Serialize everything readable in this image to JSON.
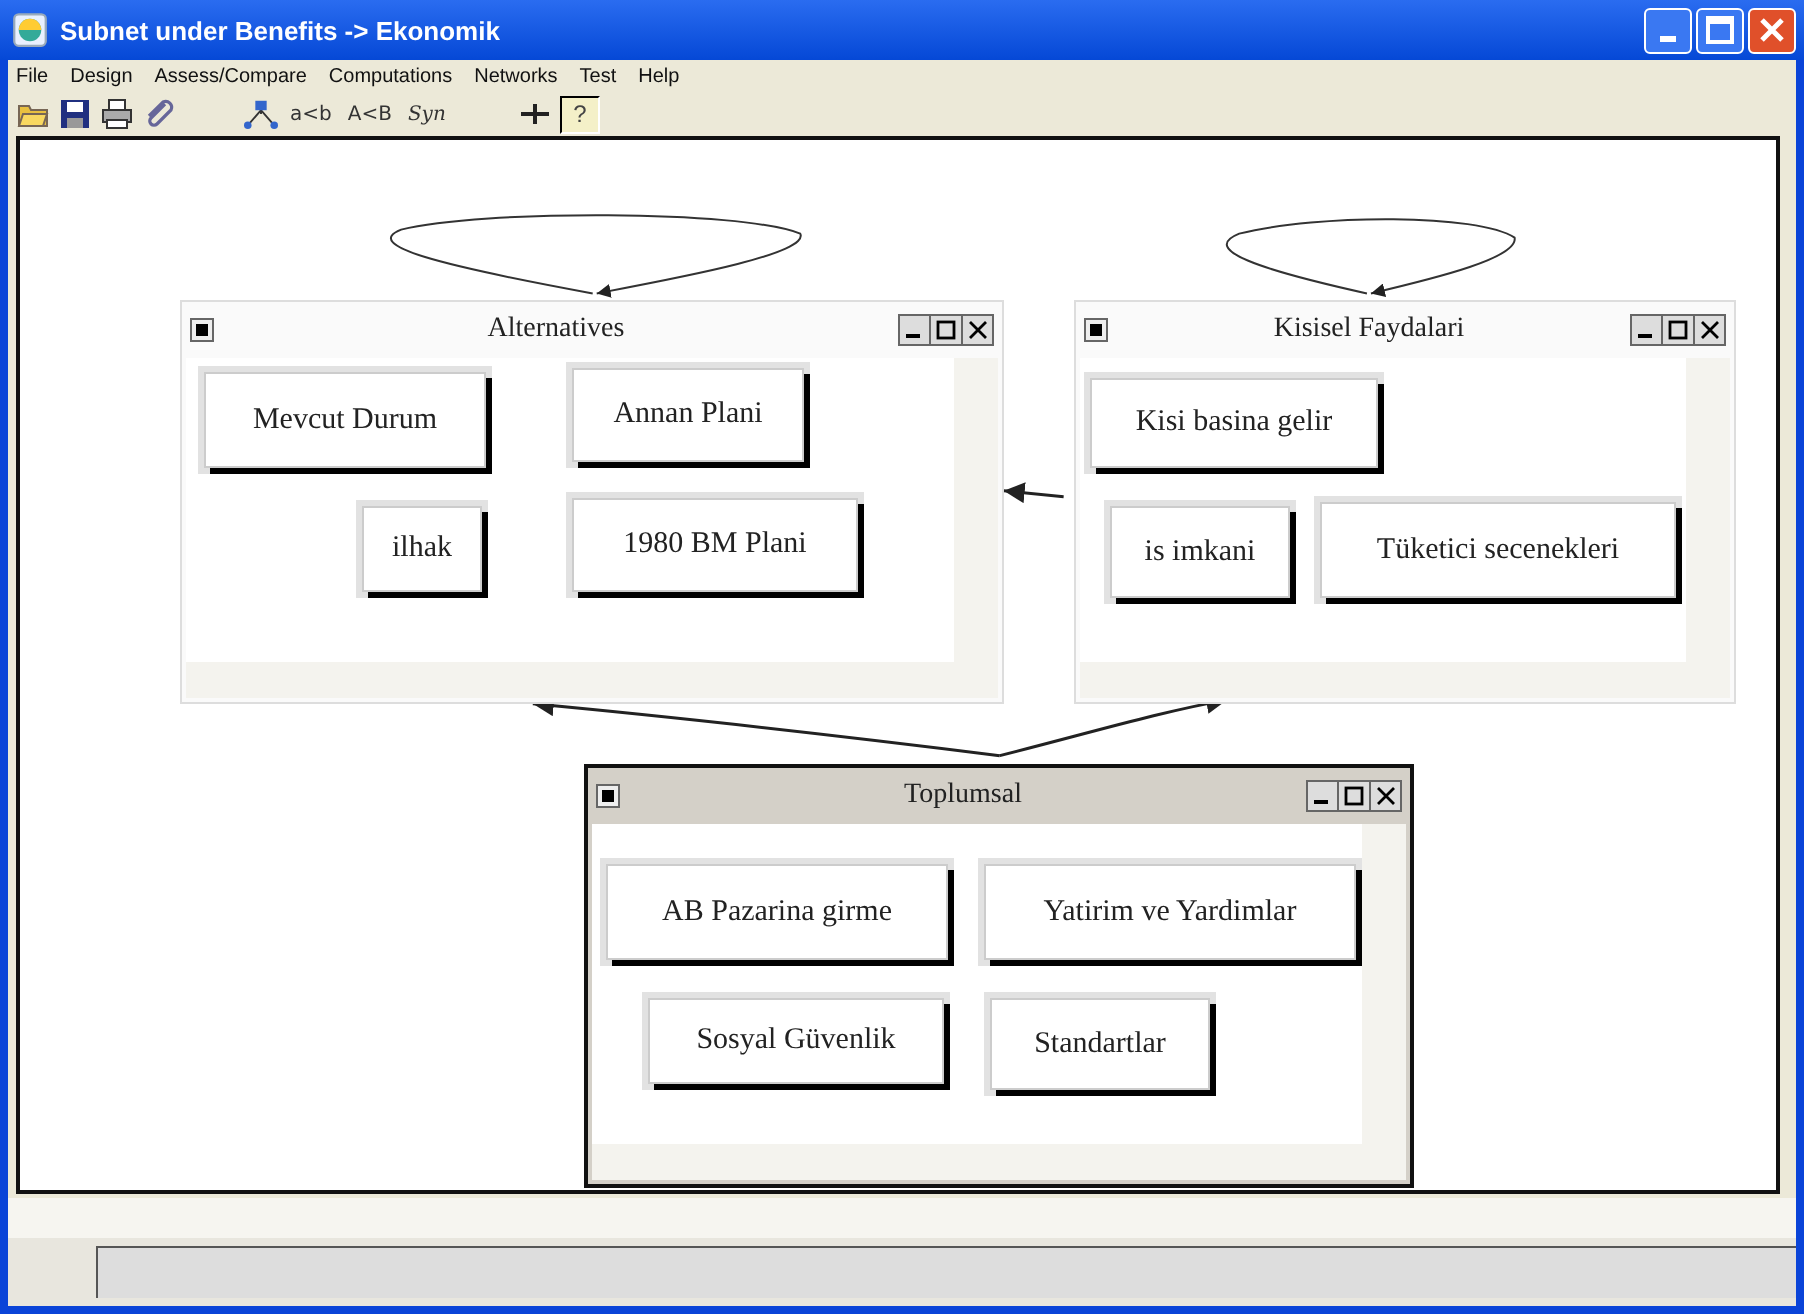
{
  "window": {
    "title": "Subnet under Benefits -> Ekonomik"
  },
  "menu": [
    "File",
    "Design",
    "Assess/Compare",
    "Computations",
    "Networks",
    "Test",
    "Help"
  ],
  "toolbar": [
    {
      "kind": "open"
    },
    {
      "kind": "save"
    },
    {
      "kind": "print"
    },
    {
      "kind": "clip"
    },
    {
      "kind": "network"
    },
    {
      "kind": "text",
      "label": "a<b"
    },
    {
      "kind": "text",
      "label": "A<B"
    },
    {
      "kind": "text",
      "label": "Syn",
      "italic": true
    },
    {
      "kind": "cross"
    },
    {
      "kind": "help",
      "label": "?"
    }
  ],
  "subnets": [
    {
      "title": "Alternatives",
      "selected": false,
      "nodes": [
        "Mevcut Durum",
        "Annan Plani",
        "ilhak",
        "1980 BM Plani"
      ]
    },
    {
      "title": "Kisisel Faydalari",
      "selected": false,
      "nodes": [
        "Kisi basina gelir",
        "is imkani",
        "Tüketici secenekleri"
      ]
    },
    {
      "title": "Toplumsal",
      "selected": true,
      "nodes": [
        "AB Pazarina girme",
        "Yatirim ve Yardimlar",
        "Sosyal Güvenlik",
        "Standartlar"
      ]
    }
  ]
}
